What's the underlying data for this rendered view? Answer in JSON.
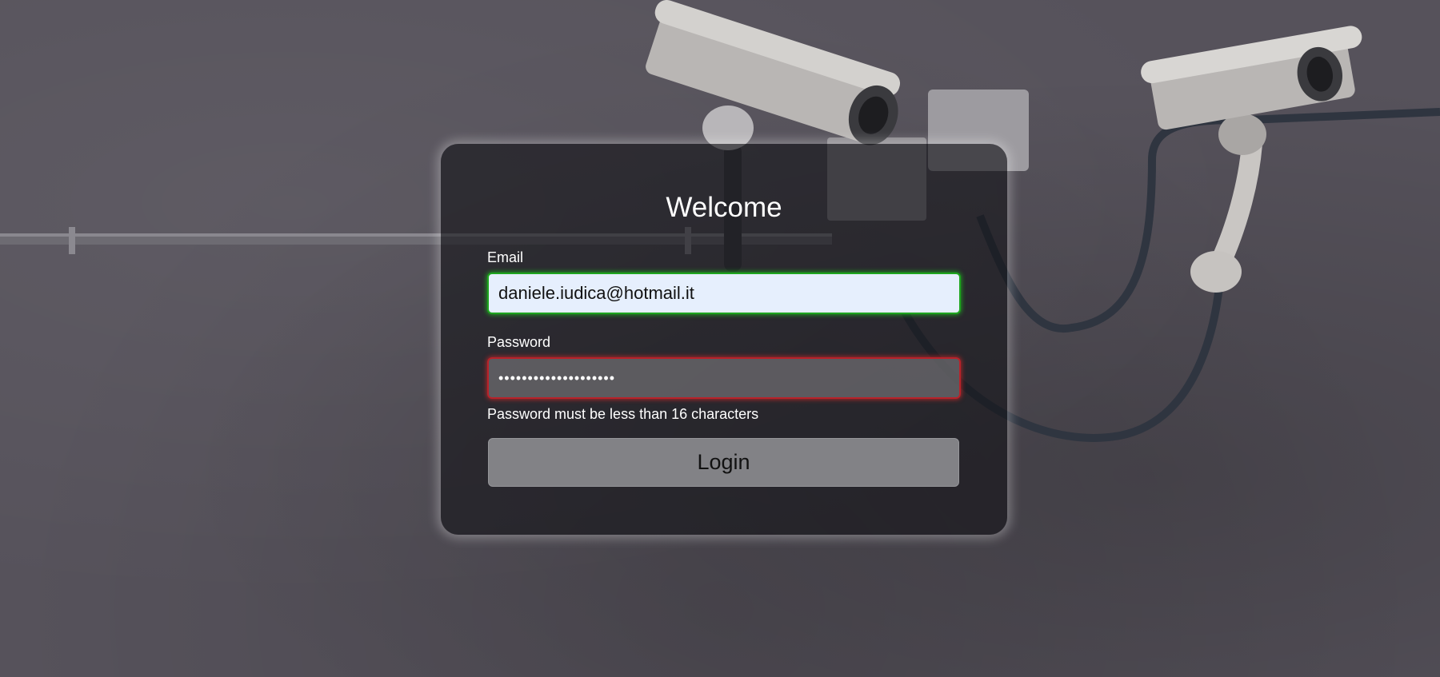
{
  "login": {
    "title": "Welcome",
    "email_label": "Email",
    "email_value": "daniele.iudica@hotmail.it",
    "password_label": "Password",
    "password_value": "••••••••••••••••••••",
    "password_error": "Password must be less than 16 characters",
    "login_label": "Login"
  },
  "colors": {
    "email_valid_border": "#1ea51e",
    "password_invalid_border": "#b8222a",
    "card_background": "rgba(20,20,24,0.62)"
  }
}
